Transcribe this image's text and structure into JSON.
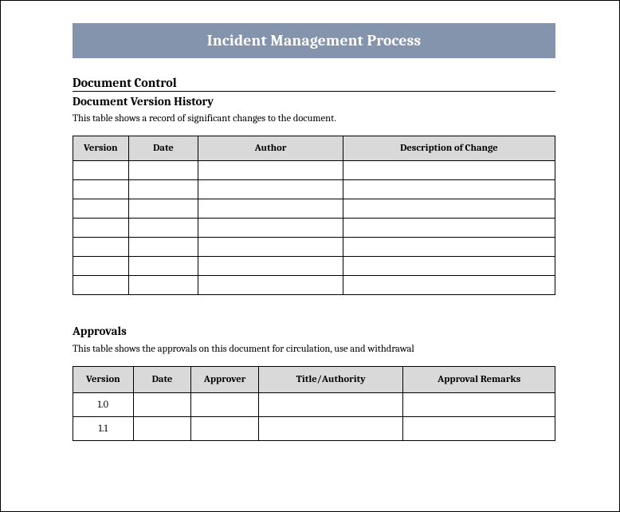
{
  "banner": {
    "title": "Incident Management Process"
  },
  "section1": {
    "heading": "Document Control",
    "subheading": "Document Version History",
    "caption": "This table shows a record of significant changes to the document.",
    "headers": [
      "Version",
      "Date",
      "Author",
      "Description of Change"
    ],
    "rows": [
      [
        "",
        "",
        "",
        ""
      ],
      [
        "",
        "",
        "",
        ""
      ],
      [
        "",
        "",
        "",
        ""
      ],
      [
        "",
        "",
        "",
        ""
      ],
      [
        "",
        "",
        "",
        ""
      ],
      [
        "",
        "",
        "",
        ""
      ],
      [
        "",
        "",
        "",
        ""
      ]
    ]
  },
  "section2": {
    "subheading": "Approvals",
    "caption": "This table shows the approvals on this document for circulation, use and withdrawal",
    "headers": [
      "Version",
      "Date",
      "Approver",
      "Title/Authority",
      "Approval Remarks"
    ],
    "rows": [
      [
        "1.0",
        "",
        "",
        "",
        ""
      ],
      [
        "1.1",
        "",
        "",
        "",
        ""
      ]
    ]
  }
}
